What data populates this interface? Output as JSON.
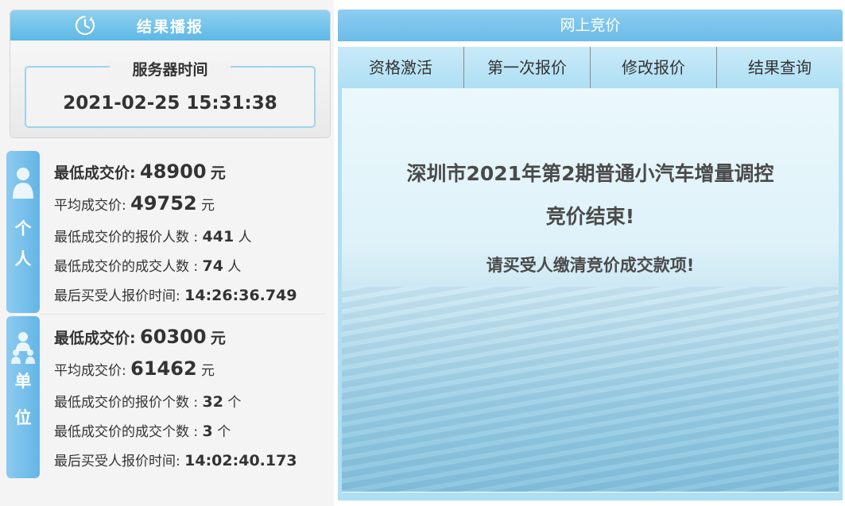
{
  "result_panel": {
    "title": "结果播报",
    "server_time_label": "服务器时间",
    "server_time": "2021-02-25 15:31:38"
  },
  "person": {
    "tab_chars": [
      "个",
      "人"
    ],
    "min_price_label": "最低成交价:",
    "min_price": "48900",
    "min_price_unit": "元",
    "avg_price_label": "平均成交价:",
    "avg_price": "49752",
    "avg_price_unit": "元",
    "min_bid_count_label": "最低成交价的报价人数 :",
    "min_bid_count": "441",
    "min_bid_count_unit": "人",
    "min_deal_count_label": "最低成交价的成交人数 :",
    "min_deal_count": "74",
    "min_deal_count_unit": "人",
    "last_bid_time_label": "最后买受人报价时间:",
    "last_bid_time": "14:26:36.749"
  },
  "org": {
    "tab_chars": [
      "单",
      "位"
    ],
    "min_price_label": "最低成交价:",
    "min_price": "60300",
    "min_price_unit": "元",
    "avg_price_label": "平均成交价:",
    "avg_price": "61462",
    "avg_price_unit": "元",
    "min_bid_count_label": "最低成交价的报价个数 :",
    "min_bid_count": "32",
    "min_bid_count_unit": "个",
    "min_deal_count_label": "最低成交价的成交个数 :",
    "min_deal_count": "3",
    "min_deal_count_unit": "个",
    "last_bid_time_label": "最后买受人报价时间:",
    "last_bid_time": "14:02:40.173"
  },
  "bidding": {
    "header": "网上竞价",
    "tabs": [
      "资格激活",
      "第一次报价",
      "修改报价",
      "结果查询"
    ],
    "message_line1": "深圳市2021年第2期普通小汽车增量调控",
    "message_line2": "竞价结束!",
    "message_line3": "请买受人缴清竞价成交款项!"
  },
  "colors": {
    "accent_blue": "#6cbbe8",
    "tab_bg": "#aedff4",
    "text": "#333333"
  },
  "icons": {
    "result_header": "clock-refresh-icon",
    "person_tab": "person-icon",
    "org_tab": "group-icon"
  }
}
